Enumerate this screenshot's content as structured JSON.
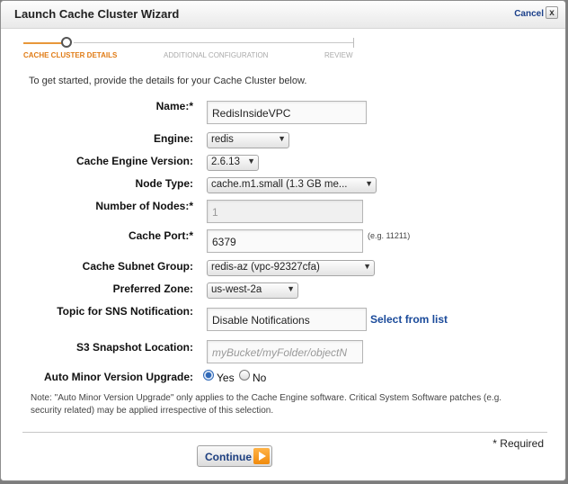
{
  "dialog": {
    "title": "Launch Cache Cluster Wizard",
    "cancel_label": "Cancel",
    "close_glyph": "x"
  },
  "steps": [
    {
      "label": "CACHE CLUSTER DETAILS",
      "state": "active"
    },
    {
      "label": "ADDITIONAL CONFIGURATION",
      "state": "pending"
    },
    {
      "label": "REVIEW",
      "state": "pending"
    }
  ],
  "intro": "To get started, provide the details for your Cache Cluster below.",
  "form": {
    "name": {
      "label": "Name:*",
      "value": "RedisInsideVPC"
    },
    "engine": {
      "label": "Engine:",
      "value": "redis"
    },
    "engine_version": {
      "label": "Cache Engine Version:",
      "value": "2.6.13"
    },
    "node_type": {
      "label": "Node Type:",
      "value": "cache.m1.small (1.3 GB me..."
    },
    "num_nodes": {
      "label": "Number of Nodes:*",
      "value": "1"
    },
    "cache_port": {
      "label": "Cache Port:*",
      "value": "6379",
      "hint": "(e.g. 11211)"
    },
    "subnet_group": {
      "label": "Cache Subnet Group:",
      "value": "redis-az (vpc-92327cfa)"
    },
    "preferred_zone": {
      "label": "Preferred Zone:",
      "value": "us-west-2a"
    },
    "sns_topic": {
      "label": "Topic for SNS Notification:",
      "value": "Disable Notifications",
      "link": "Select from list"
    },
    "s3_snapshot": {
      "label": "S3 Snapshot Location:",
      "placeholder": "myBucket/myFolder/objectN"
    },
    "auto_minor_upgrade": {
      "label": "Auto Minor Version Upgrade:",
      "yes_label": "Yes",
      "no_label": "No",
      "selected": "Yes"
    }
  },
  "note": "Note: \"Auto Minor Version Upgrade\" only applies to the Cache Engine software. Critical System Software patches (e.g. security related) may be applied irrespective of this selection.",
  "required_label": "* Required",
  "continue_label": "Continue",
  "colors": {
    "accent": "#e07b15",
    "link": "#1a4a9a",
    "radio_selected": "#2f68b7"
  },
  "icons": {
    "select_arrow": "▼"
  }
}
